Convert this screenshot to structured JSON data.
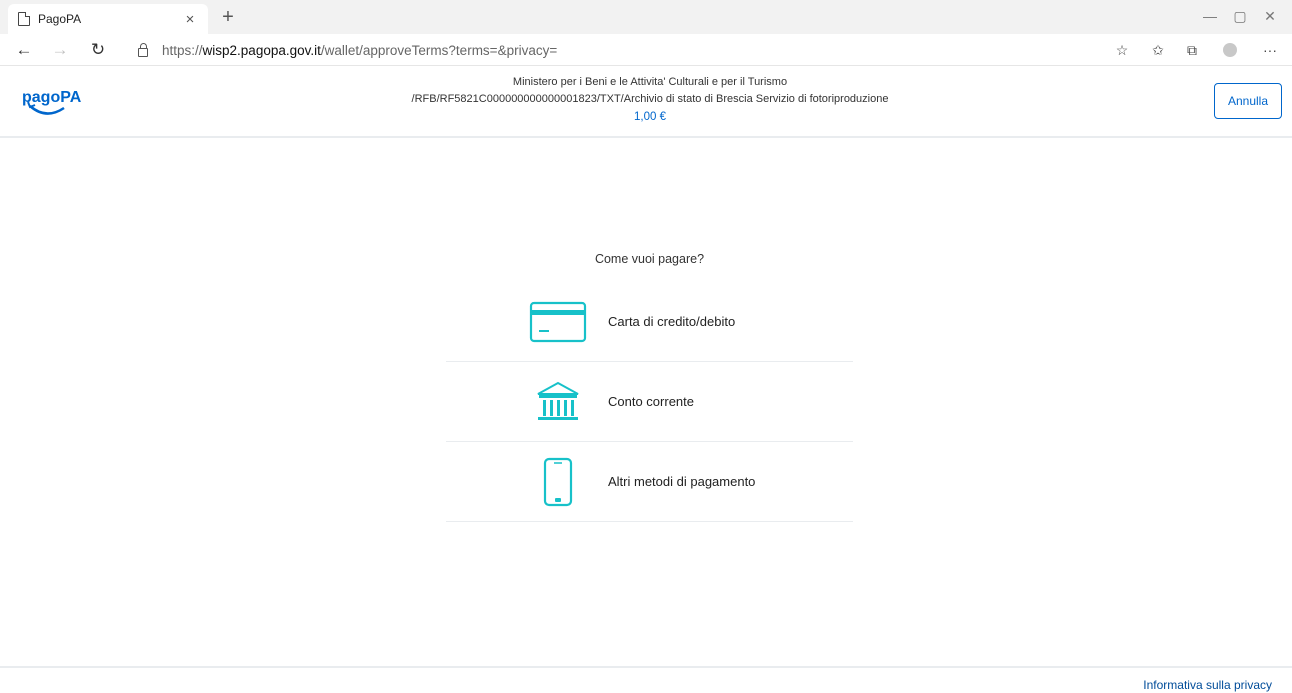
{
  "browser": {
    "tab_title": "PagoPA",
    "tab_close": "×",
    "new_tab": "+",
    "url_scheme": "https://",
    "url_host": "wisp2.pagopa.gov.it",
    "url_path": "/wallet/approveTerms?terms=&privacy=",
    "more_label": "···"
  },
  "header": {
    "logo_text": "pagoPA",
    "creditor": "Ministero per i Beni e le Attivita' Culturali e per il Turismo",
    "causale": "/RFB/RF5821C000000000000001823/TXT/Archivio di stato di Brescia Servizio di fotoriproduzione",
    "amount": "1,00 €",
    "cancel_label": "Annulla"
  },
  "main": {
    "question": "Come vuoi pagare?",
    "methods": [
      {
        "label": "Carta di credito/debito",
        "icon": "credit-card-icon"
      },
      {
        "label": "Conto corrente",
        "icon": "bank-icon"
      },
      {
        "label": "Altri metodi di pagamento",
        "icon": "smartphone-icon"
      }
    ]
  },
  "footer": {
    "privacy_label": "Informativa sulla privacy"
  },
  "colors": {
    "accent": "#0066cc",
    "icon_teal": "#17c1c9"
  }
}
